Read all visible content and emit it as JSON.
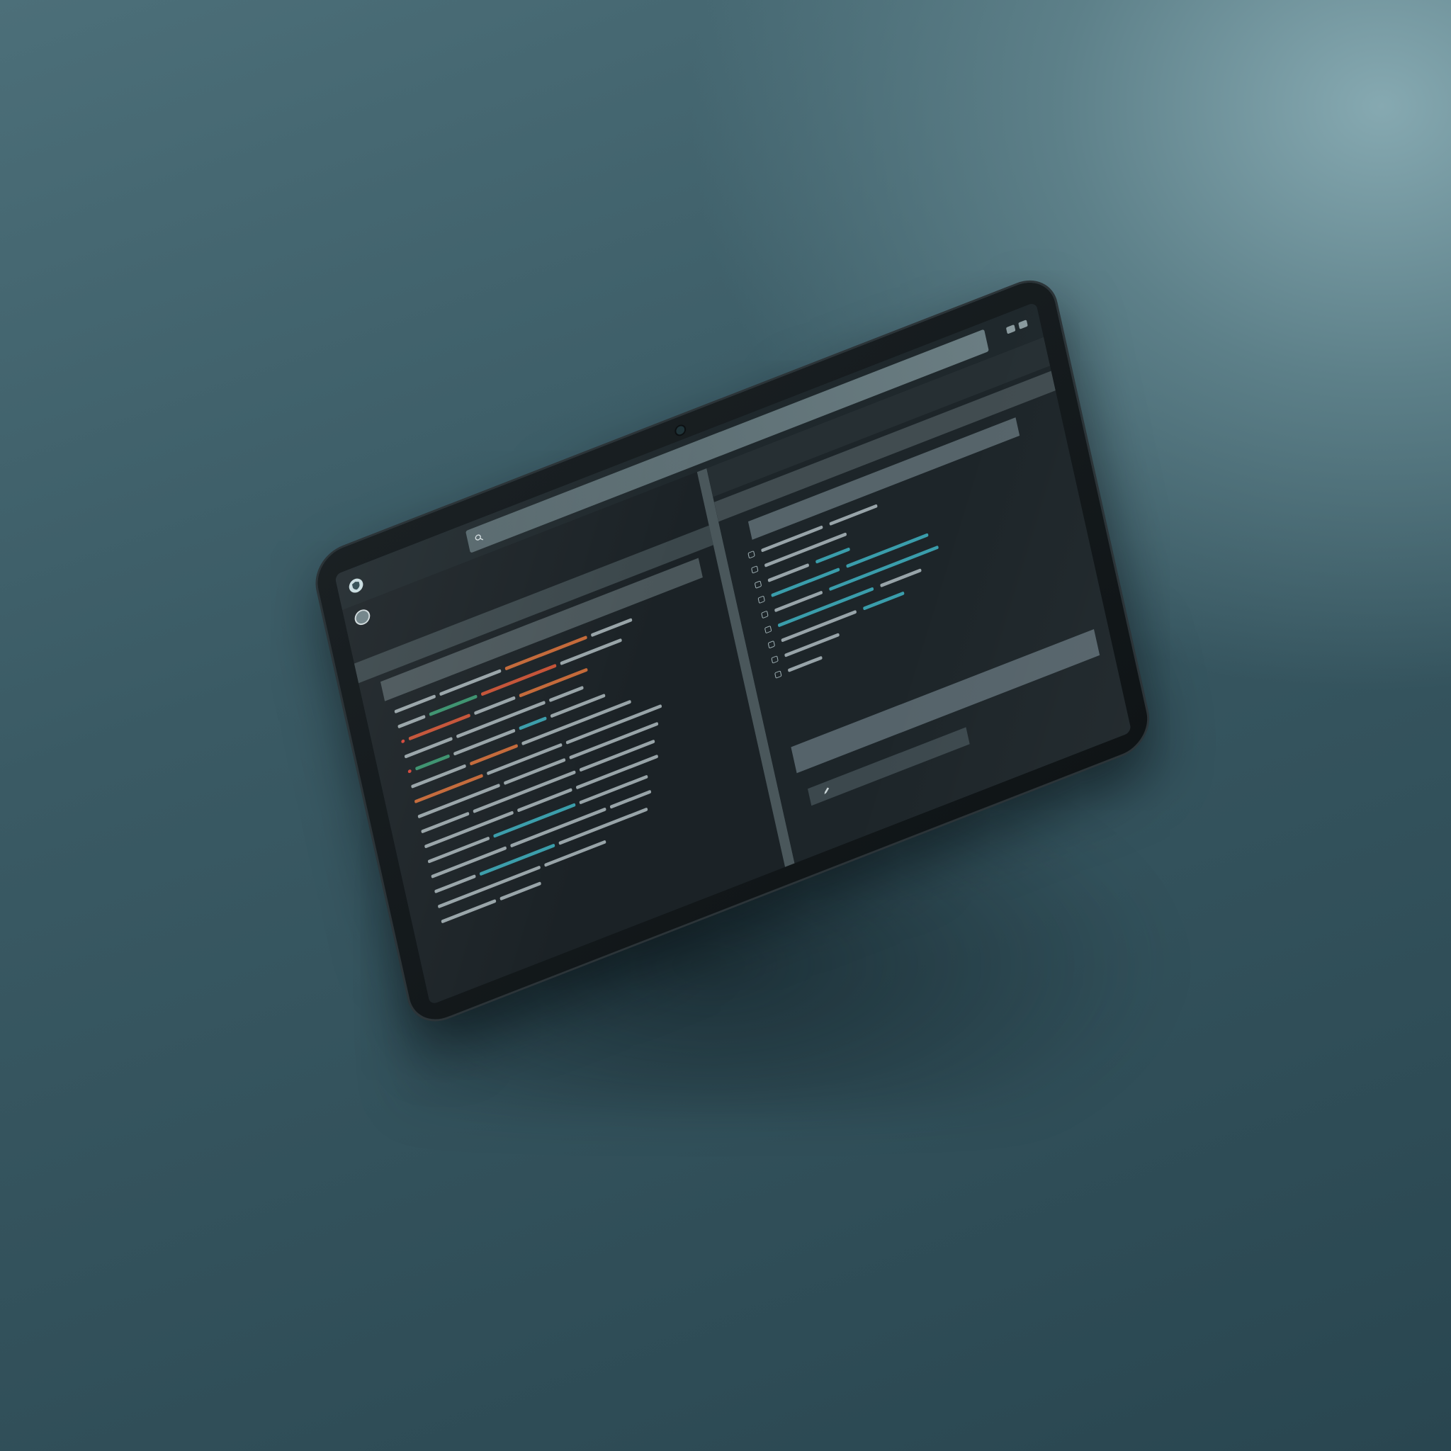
{
  "colors": {
    "background_light": "#86a9b1",
    "background_dark": "#294650",
    "device_bezel": "#0f1416",
    "screen_bg": "#1c2428",
    "accent_red": "#e25a3a",
    "accent_orange": "#e1743c",
    "accent_green": "#3fa57a",
    "accent_teal": "#3fb3c2"
  },
  "icons": {
    "logo": "shield-logo-icon",
    "search": "search-icon",
    "edit": "pencil-icon",
    "checkbox": "checkbox-icon",
    "window_controls": "window-control-icon"
  },
  "topbar": {
    "app_title": "",
    "search_text": ""
  },
  "left_nav": {
    "items": [
      "",
      "",
      ""
    ]
  },
  "subnav": {
    "items": [
      "",
      ""
    ]
  },
  "section_bar": {
    "items": [
      "",
      ""
    ]
  },
  "code_header": {
    "title": ""
  },
  "right_pane": {
    "header_label": "",
    "header_label_right": "",
    "panel_title": "",
    "footer_label": ""
  }
}
